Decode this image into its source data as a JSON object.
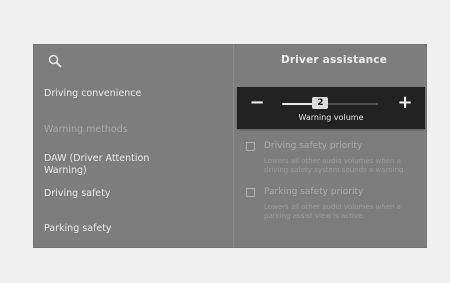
{
  "header": {
    "title": "Driver assistance",
    "search_icon": "search-icon"
  },
  "sidebar": {
    "items": [
      {
        "label": "Driving convenience"
      },
      {
        "label": "Warning methods"
      },
      {
        "label": "DAW (Driver Attention\nWarning)"
      },
      {
        "label": "Driving safety"
      },
      {
        "label": "Parking safety"
      }
    ]
  },
  "content": {
    "options": [
      {
        "title": "Driving safety priority",
        "description": "Lowers all other audio volumes when a driving safety system sounds a warning."
      },
      {
        "title": "Parking safety priority",
        "description": "Lowers all other audio volumes when a parking assist view is active."
      }
    ]
  },
  "warning_volume_popup": {
    "label": "Warning volume",
    "value": "2",
    "minus_label": "−",
    "plus_label": "+",
    "level_fraction": 0.4
  },
  "colors": {
    "screen_bg": "#7d7d7d",
    "popup_bg": "#222222",
    "text": "#e6e6e6"
  }
}
